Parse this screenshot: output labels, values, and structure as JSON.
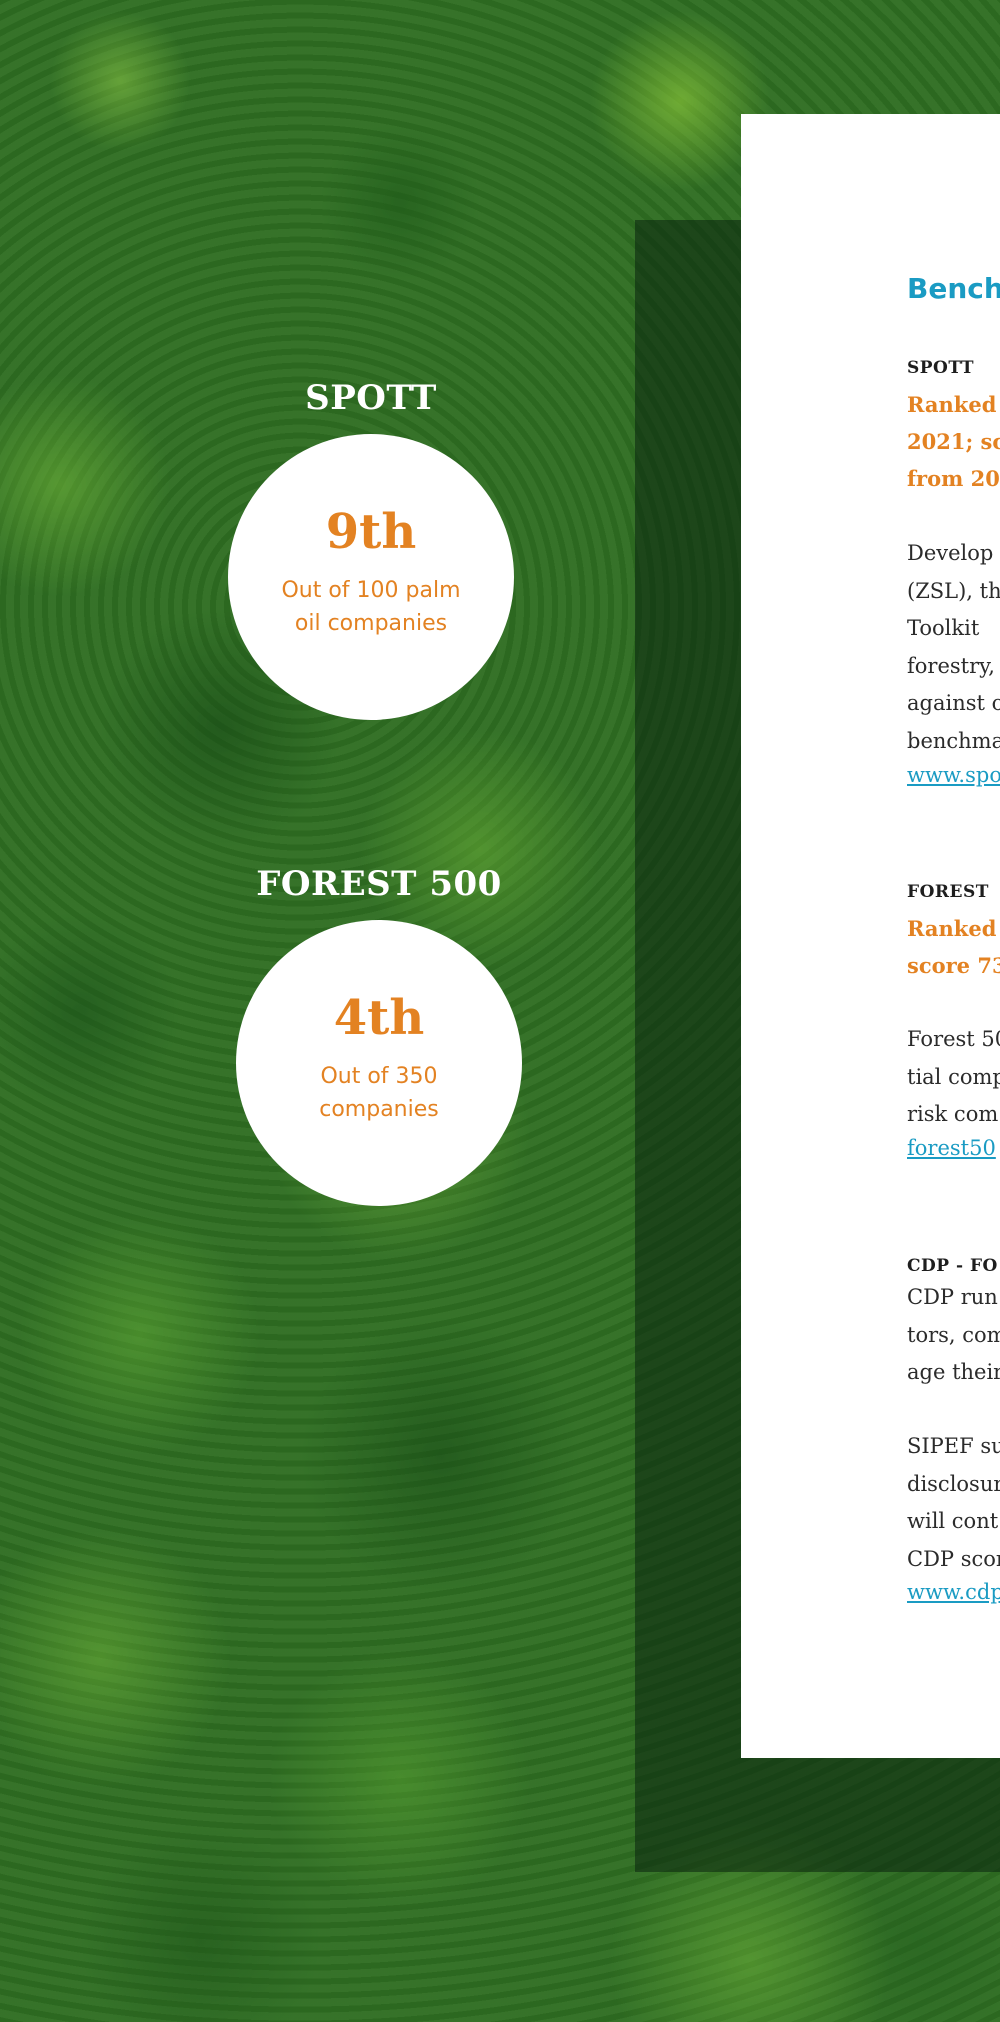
{
  "badges": {
    "spott": {
      "title": "SPOTT",
      "rank": "9th",
      "sub_line1": "Out of 100 palm",
      "sub_line2": "oil companies"
    },
    "forest500": {
      "title": "FOREST 500",
      "rank": "4th",
      "sub_line1": "Out of 350",
      "sub_line2": "companies"
    }
  },
  "panel": {
    "heading": "Benchn",
    "spott": {
      "title": "SPOTT",
      "highlight": [
        "Ranked",
        "2021; sc",
        "from 20"
      ],
      "body": [
        "Develop",
        "(ZSL), th",
        "Toolkit",
        "forestry,",
        "against o",
        "benchma"
      ],
      "link": "www.spo"
    },
    "forest500": {
      "title": "FOREST",
      "highlight": [
        "Ranked",
        "score 73"
      ],
      "body": [
        "Forest 50",
        "tial comp",
        "risk com"
      ],
      "link": "forest50"
    },
    "cdp": {
      "title": "CDP - FO",
      "body1": [
        "CDP run",
        "tors, com",
        "age their"
      ],
      "body2": [
        "SIPEF su",
        "disclosur",
        "will cont",
        "CDP scor"
      ],
      "link": "www.cdp"
    }
  },
  "colors": {
    "accent_orange": "#e38222",
    "accent_blue": "#1a9bc3"
  }
}
